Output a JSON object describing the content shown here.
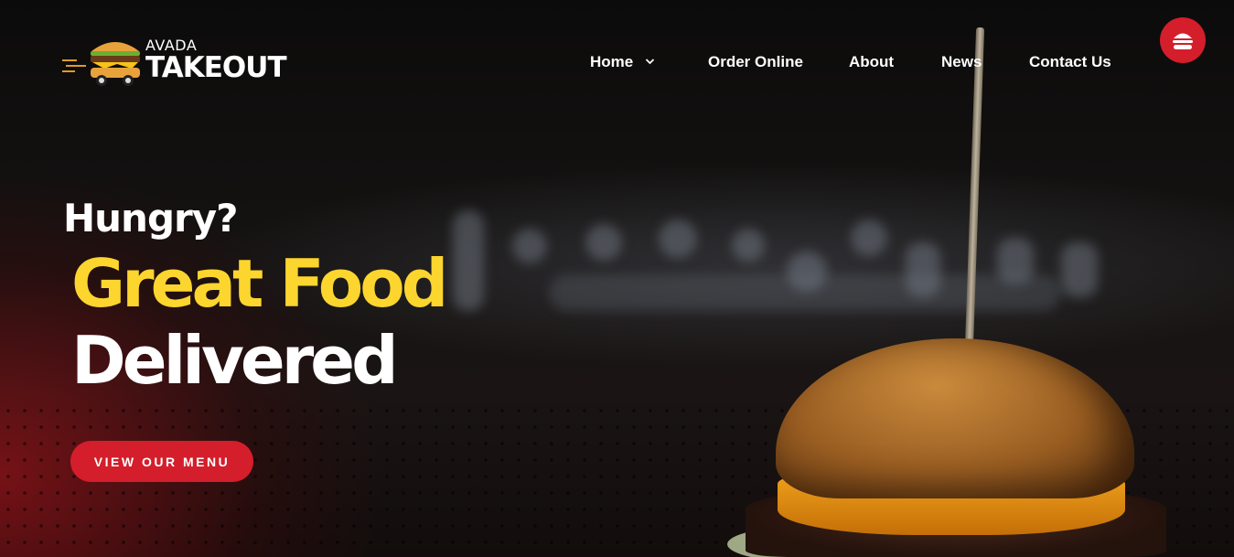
{
  "brand": {
    "small_text": "AVADA",
    "big_text": "TAKEOUT",
    "logo_icon": "burger-truck-icon"
  },
  "nav": {
    "items": [
      {
        "label": "Home",
        "has_dropdown": true
      },
      {
        "label": "Order Online"
      },
      {
        "label": "About"
      },
      {
        "label": "News"
      },
      {
        "label": "Contact Us"
      }
    ],
    "dropdown_icon": "chevron-down-icon",
    "menu_button_icon": "burger-icon"
  },
  "hero": {
    "line1": "Hungry?",
    "line2": "Great Food",
    "line3": "Delivered",
    "cta_label": "VIEW OUR MENU",
    "image": "burger-photo"
  },
  "colors": {
    "accent_red": "#d41e2b",
    "accent_yellow": "#fcd52e",
    "text": "#ffffff",
    "background": "#0b0a0a"
  }
}
